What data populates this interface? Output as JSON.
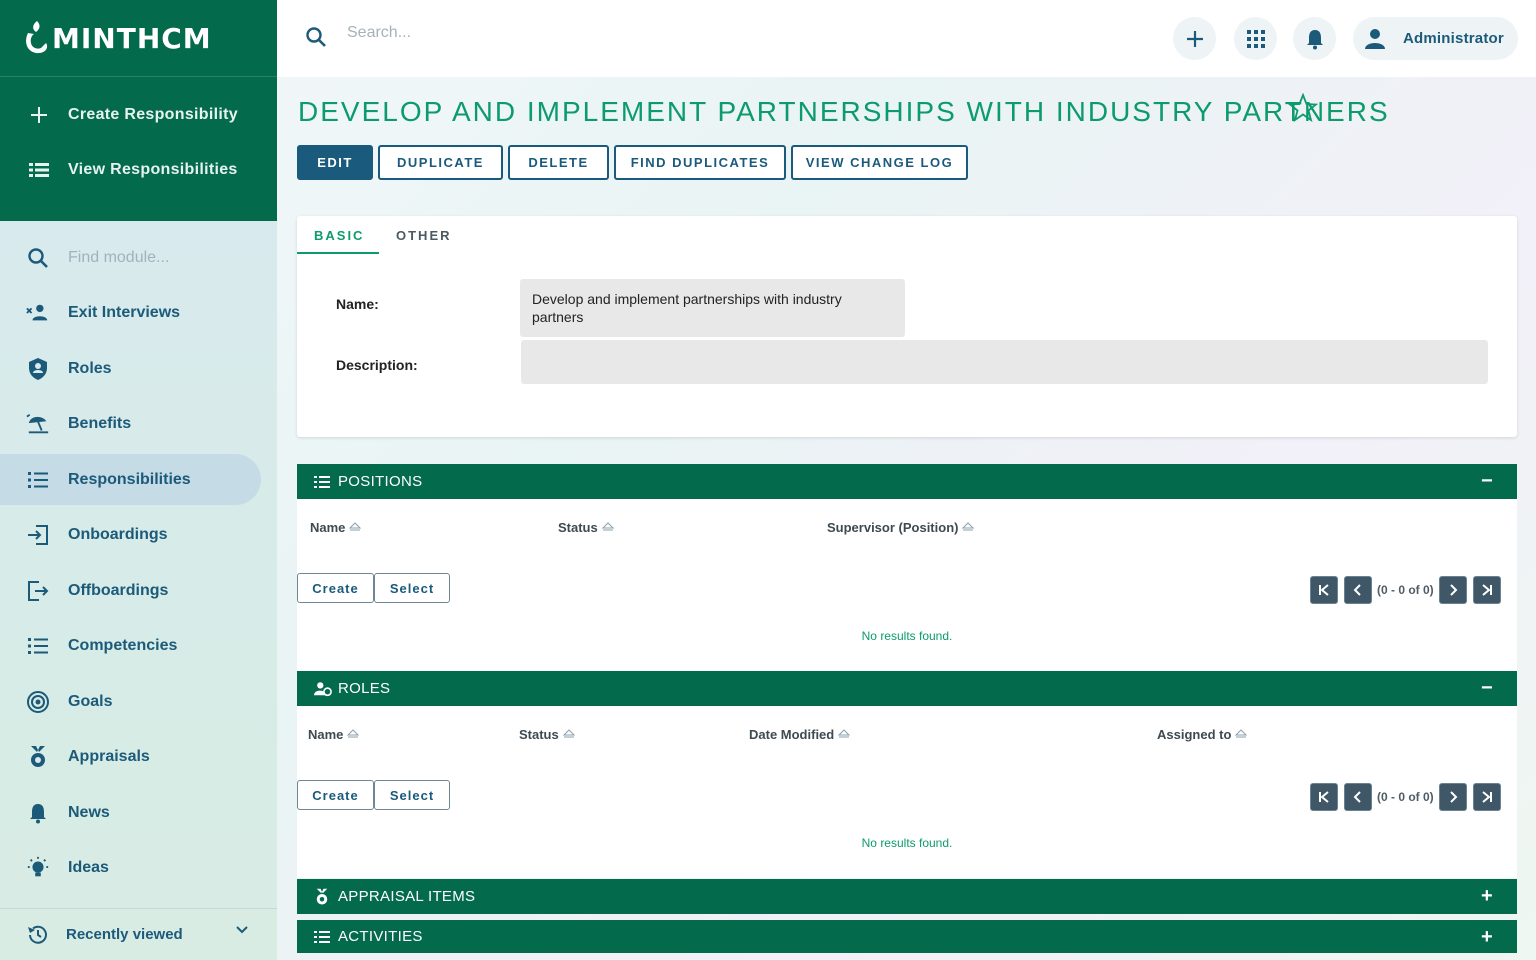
{
  "app": {
    "logo_text": "minthcm"
  },
  "sidebar": {
    "actions": [
      {
        "label": "Create Responsibility",
        "icon": "plus-icon"
      },
      {
        "label": "View Responsibilities",
        "icon": "list-icon"
      }
    ],
    "search_placeholder": "Find module...",
    "items": [
      {
        "label": "Exit Interviews",
        "icon": "person-remove-icon"
      },
      {
        "label": "Roles",
        "icon": "shield-icon"
      },
      {
        "label": "Benefits",
        "icon": "beach-umbrella-icon"
      },
      {
        "label": "Responsibilities",
        "icon": "list-icon",
        "active": true
      },
      {
        "label": "Onboardings",
        "icon": "login-icon"
      },
      {
        "label": "Offboardings",
        "icon": "logout-icon"
      },
      {
        "label": "Competencies",
        "icon": "list-icon"
      },
      {
        "label": "Goals",
        "icon": "target-icon"
      },
      {
        "label": "Appraisals",
        "icon": "medal-icon"
      },
      {
        "label": "News",
        "icon": "bell-icon"
      },
      {
        "label": "Ideas",
        "icon": "lightbulb-icon"
      }
    ],
    "recently_viewed": "Recently viewed"
  },
  "header": {
    "search_placeholder": "Search...",
    "user_name": "Administrator"
  },
  "record": {
    "title": "DEVELOP AND IMPLEMENT PARTNERSHIPS WITH INDUSTRY PARTNERS",
    "actions": [
      "EDIT",
      "DUPLICATE",
      "DELETE",
      "FIND DUPLICATES",
      "VIEW CHANGE LOG"
    ],
    "tabs": [
      "BASIC",
      "OTHER"
    ],
    "fields": {
      "name_label": "Name:",
      "name_value": "Develop and implement partnerships with industry partners",
      "description_label": "Description:",
      "description_value": ""
    }
  },
  "panels": {
    "positions": {
      "title": "POSITIONS",
      "toggle": "−",
      "columns": [
        "Name",
        "Status",
        "Supervisor (Position)"
      ],
      "create_label": "Create",
      "select_label": "Select",
      "pagination": "(0 - 0 of 0)",
      "empty": "No results found."
    },
    "roles": {
      "title": "ROLES",
      "toggle": "−",
      "columns": [
        "Name",
        "Status",
        "Date Modified",
        "Assigned to"
      ],
      "create_label": "Create",
      "select_label": "Select",
      "pagination": "(0 - 0 of 0)",
      "empty": "No results found."
    },
    "appraisal_items": {
      "title": "APPRAISAL ITEMS",
      "toggle": "+"
    },
    "activities": {
      "title": "ACTIVITIES",
      "toggle": "+"
    }
  },
  "colors": {
    "brand_green": "#046a4c",
    "accent_green": "#0d9b6c",
    "primary_blue": "#1a5a7d"
  }
}
